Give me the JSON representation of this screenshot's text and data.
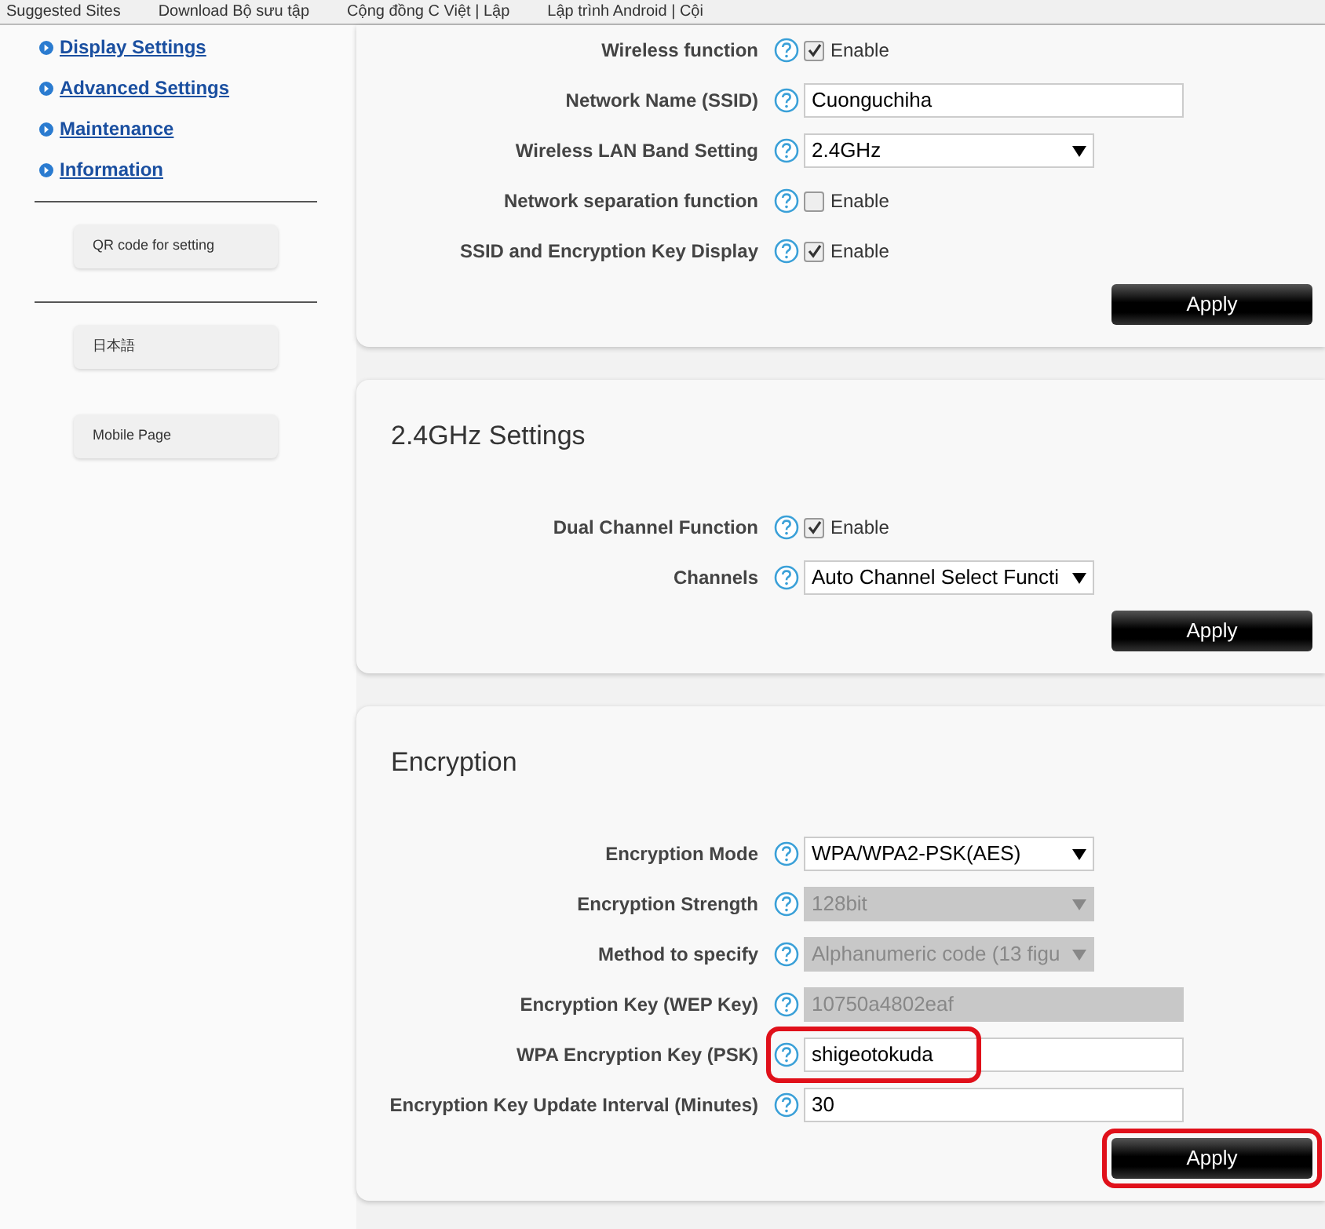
{
  "bookmarks": [
    "Suggested Sites",
    "Download Bộ sưu tập",
    "Cộng đồng C Việt | Lập",
    "Lập trình Android | Cội"
  ],
  "sidebar": {
    "links": [
      "Display Settings",
      "Advanced Settings",
      "Maintenance",
      "Information"
    ],
    "groups": [
      [
        "QR code for setting"
      ],
      [
        "日本語",
        "Mobile Page"
      ]
    ]
  },
  "cards": [
    {
      "rows": [
        {
          "label": "Wireless function",
          "kind": "checkbox",
          "checked": true,
          "text": "Enable",
          "disabled": false,
          "highlighted": false
        },
        {
          "label": "Network Name (SSID)",
          "kind": "text",
          "value": "Cuonguchiha",
          "disabled": false,
          "highlighted": false
        },
        {
          "label": "Wireless LAN Band Setting",
          "kind": "select",
          "value": "2.4GHz",
          "disabled": false,
          "highlighted": false
        },
        {
          "label": "Network separation function",
          "kind": "checkbox",
          "checked": false,
          "text": "Enable",
          "disabled": false,
          "highlighted": false
        },
        {
          "label": "SSID and Encryption Key Display",
          "kind": "checkbox",
          "checked": true,
          "text": "Enable",
          "disabled": false,
          "highlighted": false
        }
      ],
      "button": {
        "label": "Apply",
        "highlighted": false
      }
    },
    {
      "title": "2.4GHz Settings",
      "rows": [
        {
          "label": "Dual Channel Function",
          "kind": "checkbox",
          "checked": true,
          "text": "Enable",
          "disabled": false,
          "highlighted": false
        },
        {
          "label": "Channels",
          "kind": "select",
          "value": "Auto Channel Select Functi",
          "disabled": false,
          "highlighted": false
        }
      ],
      "button": {
        "label": "Apply",
        "highlighted": false
      }
    },
    {
      "title": "Encryption",
      "rows": [
        {
          "label": "Encryption Mode",
          "kind": "select",
          "value": "WPA/WPA2-PSK(AES)",
          "disabled": false,
          "highlighted": false
        },
        {
          "label": "Encryption Strength",
          "kind": "select",
          "value": "128bit",
          "disabled": true,
          "highlighted": false
        },
        {
          "label": "Method to specify",
          "kind": "select",
          "value": "Alphanumeric code (13 figu",
          "disabled": true,
          "highlighted": false
        },
        {
          "label": "Encryption Key (WEP Key)",
          "kind": "text",
          "value": "10750a4802eaf",
          "disabled": true,
          "highlighted": false
        },
        {
          "label": "WPA Encryption Key (PSK)",
          "kind": "text",
          "value": "shigeotokuda",
          "disabled": false,
          "highlighted": true
        },
        {
          "label": "Encryption Key Update Interval (Minutes)",
          "kind": "text",
          "value": "30",
          "disabled": false,
          "highlighted": false
        }
      ],
      "button": {
        "label": "Apply",
        "highlighted": true
      }
    }
  ]
}
